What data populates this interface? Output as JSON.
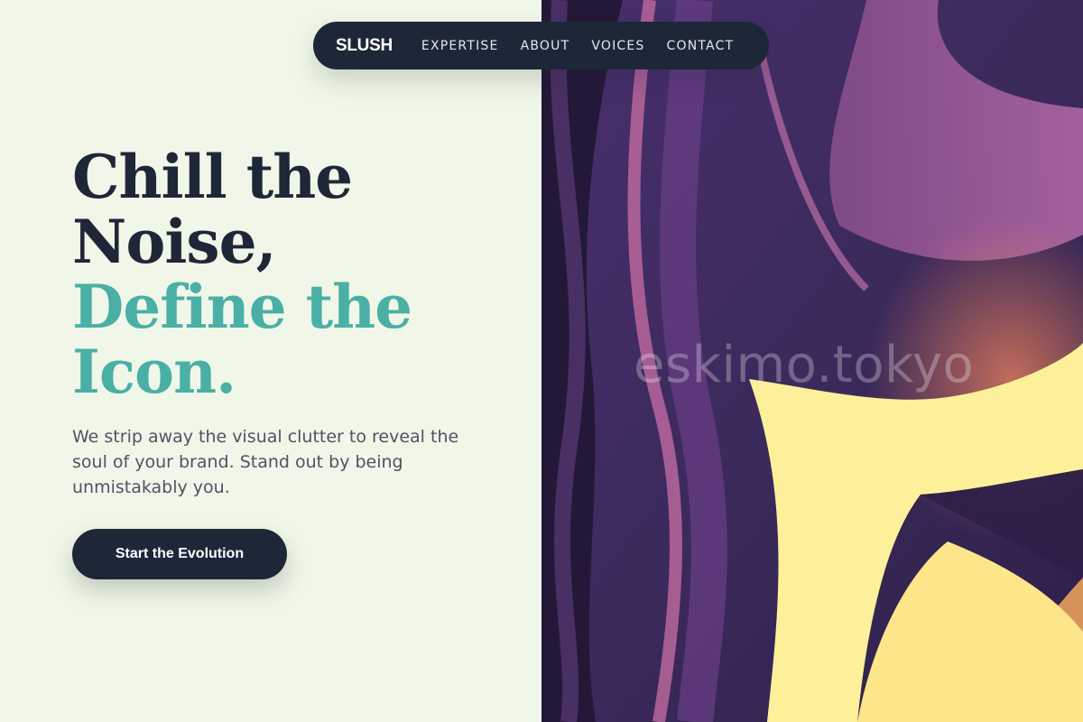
{
  "nav": {
    "logo": "SLUSH",
    "links": [
      "EXPERTISE",
      "ABOUT",
      "VOICES",
      "CONTACT"
    ]
  },
  "hero": {
    "title_lines": [
      "Chill the",
      "Noise,"
    ],
    "accent_lines": [
      "Define the",
      "Icon."
    ],
    "description": "We strip away the visual clutter to reveal the soul of your brand. Stand out by being unmistakably you.",
    "cta_label": "Start the Evolution"
  },
  "art": {
    "watermark": "eskimo.tokyo"
  },
  "colors": {
    "background": "#f0f7e8",
    "navy": "#1e2738",
    "accent_teal": "#4aafa5",
    "art_purple": "#3b2a5c",
    "art_yellow": "#fdf09a",
    "art_magenta": "#c45a9a"
  }
}
